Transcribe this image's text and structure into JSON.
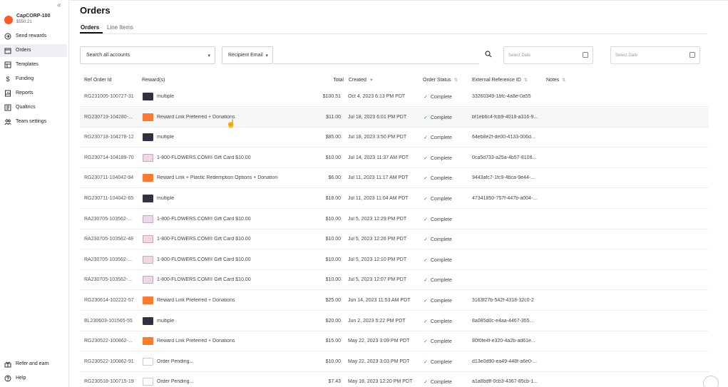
{
  "sidebar": {
    "collapse_glyph": "«",
    "account": {
      "name": "CapCORP-100",
      "balance": "$550.21"
    },
    "items": [
      {
        "label": "Send rewards",
        "icon": "send-icon"
      },
      {
        "label": "Orders",
        "icon": "orders-icon",
        "active": true
      },
      {
        "label": "Templates",
        "icon": "templates-icon"
      },
      {
        "label": "Funding",
        "icon": "dollar-icon"
      },
      {
        "label": "Reports",
        "icon": "reports-icon"
      },
      {
        "label": "Qualtrics",
        "icon": "qualtrics-icon"
      },
      {
        "label": "Team settings",
        "icon": "team-icon"
      }
    ],
    "bottom": [
      {
        "label": "Refer and earn",
        "icon": "gift-icon"
      },
      {
        "label": "Help",
        "icon": "help-icon"
      }
    ]
  },
  "page": {
    "title": "Orders"
  },
  "tabs": [
    {
      "label": "Orders",
      "active": true
    },
    {
      "label": "Line Items"
    }
  ],
  "filters": {
    "accounts_value": "Search all accounts",
    "field_select": "Recipient Email",
    "search_placeholder": "",
    "date_from_placeholder": "Select Date",
    "date_to_placeholder": "Select Date"
  },
  "table": {
    "headers": {
      "ref": "Ref Order Id",
      "rewards": "Reward(s)",
      "total": "Total",
      "created": "Created",
      "status": "Order Status",
      "ext": "External Reference ID",
      "notes": "Notes"
    },
    "rows": [
      {
        "id": "RG231005-100727-31",
        "thumb": "multi",
        "reward": "multiple",
        "total": "$100.51",
        "created": "Oct 4, 2023 6:13 PM PDT",
        "status": "Complete",
        "ext": "33260349-1bfc-4a8e-0a55"
      },
      {
        "id": "RG230719-104280-...",
        "thumb": "orange",
        "reward": "Reward Link Preferred + Donations",
        "total": "$11.00",
        "created": "Jul 18, 2023 6:01 PM PDT",
        "status": "Complete",
        "ext": "bf1eb6c4-fcb9-4018-a316-9..."
      },
      {
        "id": "RG230718-104278-12",
        "thumb": "multi",
        "reward": "multiple",
        "total": "$85.00",
        "created": "Jul 18, 2023 3:50 PM PDT",
        "status": "Complete",
        "ext": "64eb8e2f-de00-4133-006d..."
      },
      {
        "id": "RG230714-104189-70",
        "thumb": "flower",
        "reward": "1-800-FLOWERS.COM® Gift Card $10.00",
        "total": "$10.00",
        "created": "Jul 14, 2023 11:37 AM PDT",
        "status": "Complete",
        "ext": "0ca5d733-a25a-4b57-8106..."
      },
      {
        "id": "RG230711-104042-94",
        "thumb": "orange",
        "reward": "Reward Link + Plastic Redemption Options + Donation",
        "total": "$6.00",
        "created": "Jul 11, 2023 11:17 AM PDT",
        "status": "Complete",
        "ext": "9443afc7-1fc9-4bca-9e44-..."
      },
      {
        "id": "RG230711-104042-65",
        "thumb": "multi",
        "reward": "multiple",
        "total": "$18.00",
        "created": "Jul 11, 2023 11:04 AM PDT",
        "status": "Complete",
        "ext": "47341850-757f-447b-a004-..."
      },
      {
        "id": "RA230705-103562-...",
        "thumb": "flower",
        "reward": "1-800-FLOWERS.COM® Gift Card $10.00",
        "total": "$10.00",
        "created": "Jul 5, 2023 12:29 PM PDT",
        "status": "Complete",
        "ext": ""
      },
      {
        "id": "RA230705-103562-48",
        "thumb": "flower",
        "reward": "1-800-FLOWERS.COM® Gift Card $10.00",
        "total": "$10.00",
        "created": "Jul 5, 2023 12:26 PM PDT",
        "status": "Complete",
        "ext": ""
      },
      {
        "id": "RA230705-103562-...",
        "thumb": "flower",
        "reward": "1-800-FLOWERS.COM® Gift Card $10.00",
        "total": "$10.00",
        "created": "Jul 5, 2023 12:10 PM PDT",
        "status": "Complete",
        "ext": ""
      },
      {
        "id": "RA230705-103562-...",
        "thumb": "flower",
        "reward": "1-800-FLOWERS.COM® Gift Card $10.00",
        "total": "$10.00",
        "created": "Jul 5, 2023 12:07 PM PDT",
        "status": "Complete",
        "ext": ""
      },
      {
        "id": "RG230614-102222-57",
        "thumb": "orange",
        "reward": "Reward Link Preferred + Donations",
        "total": "$25.00",
        "created": "Jun 14, 2023 11:53 AM PDT",
        "status": "Complete",
        "ext": "3163f27b-542f-4318-32c0-2"
      },
      {
        "id": "BL230603-101565-55",
        "thumb": "multi",
        "reward": "multiple",
        "total": "$20.00",
        "created": "Jun 2, 2023 5:22 PM PDT",
        "status": "Complete",
        "ext": "8a085d0c-e4aa-4467-355..."
      },
      {
        "id": "RG230522-100862-...",
        "thumb": "orange",
        "reward": "Reward Link Preferred + Donations",
        "total": "$15.00",
        "created": "May 22, 2023 3:09 PM PDT",
        "status": "Complete",
        "ext": "80f0fe4f-e320-4a2b-ad61e..."
      },
      {
        "id": "RG230522-100862-91",
        "thumb": "pending",
        "reward": "Order Pending...",
        "total": "$10.00",
        "created": "May 22, 2023 3:03 PM PDT",
        "status": "Complete",
        "ext": "d13e0d90-ea49-448f-a6e0-..."
      },
      {
        "id": "RG230518-100715-19",
        "thumb": "pending",
        "reward": "Order Pending...",
        "total": "$7.43",
        "created": "May 18, 2023 12:20 PM PDT",
        "status": "Complete",
        "ext": "a1a8bdff-0cb3-4367-85cb-1..."
      }
    ]
  },
  "colors": {
    "accent": "#ff5a1f",
    "complete": "#1f9a4a",
    "active_nav": "#eef0f4"
  }
}
